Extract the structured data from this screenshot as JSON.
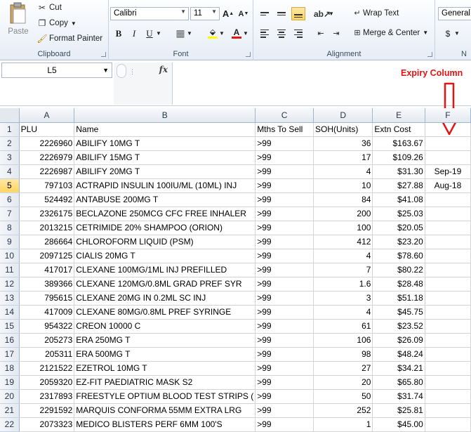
{
  "ribbon": {
    "clipboard": {
      "label": "Clipboard",
      "paste": "Paste",
      "cut": "Cut",
      "copy": "Copy",
      "format_painter": "Format Painter"
    },
    "font": {
      "label": "Font",
      "name": "Calibri",
      "size": "11",
      "bold": "B",
      "italic": "I",
      "underline": "U"
    },
    "alignment": {
      "label": "Alignment",
      "wrap_text": "Wrap Text",
      "merge_center": "Merge & Center"
    },
    "number": {
      "label": "N",
      "format": "General",
      "currency": "$"
    }
  },
  "formula_bar": {
    "name_box": "L5",
    "fx": "fx",
    "formula": ""
  },
  "annotation": {
    "text": "Expiry Column",
    "color": "#e31414"
  },
  "colors": {
    "accent": "#ffd35e",
    "header_bg": "#e4e9f0"
  },
  "sheet": {
    "columns": [
      "A",
      "B",
      "C",
      "D",
      "E",
      "F"
    ],
    "selected_row": 5,
    "rows": [
      {
        "n": "1",
        "a": "PLU",
        "b": "Name",
        "c": "Mths To Sell",
        "d": "SOH(Units)",
        "e": "Extn Cost",
        "f": ""
      },
      {
        "n": "2",
        "a": "2226960",
        "b": "ABILIFY 10MG T",
        "c": ">99",
        "d": "36",
        "e": "$163.67",
        "f": ""
      },
      {
        "n": "3",
        "a": "2226979",
        "b": "ABILIFY 15MG T",
        "c": ">99",
        "d": "17",
        "e": "$109.26",
        "f": ""
      },
      {
        "n": "4",
        "a": "2226987",
        "b": "ABILIFY 20MG T",
        "c": ">99",
        "d": "4",
        "e": "$31.30",
        "f": "Sep-19"
      },
      {
        "n": "5",
        "a": "797103",
        "b": "ACTRAPID INSULIN 100IU/ML (10ML) INJ",
        "c": ">99",
        "d": "10",
        "e": "$27.88",
        "f": "Aug-18"
      },
      {
        "n": "6",
        "a": "524492",
        "b": "ANTABUSE 200MG T",
        "c": ">99",
        "d": "84",
        "e": "$41.08",
        "f": ""
      },
      {
        "n": "7",
        "a": "2326175",
        "b": "BECLAZONE 250MCG CFC FREE INHALER",
        "c": ">99",
        "d": "200",
        "e": "$25.03",
        "f": ""
      },
      {
        "n": "8",
        "a": "2013215",
        "b": "CETRIMIDE 20% SHAMPOO (ORION)",
        "c": ">99",
        "d": "100",
        "e": "$20.05",
        "f": ""
      },
      {
        "n": "9",
        "a": "286664",
        "b": "CHLOROFORM LIQUID (PSM)",
        "c": ">99",
        "d": "412",
        "e": "$23.20",
        "f": ""
      },
      {
        "n": "10",
        "a": "2097125",
        "b": "CIALIS 20MG T",
        "c": ">99",
        "d": "4",
        "e": "$78.60",
        "f": ""
      },
      {
        "n": "11",
        "a": "417017",
        "b": "CLEXANE 100MG/1ML INJ PREFILLED",
        "c": ">99",
        "d": "7",
        "e": "$80.22",
        "f": ""
      },
      {
        "n": "12",
        "a": "389366",
        "b": "CLEXANE 120MG/0.8ML GRAD PREF SYR",
        "c": ">99",
        "d": "1.6",
        "e": "$28.48",
        "f": ""
      },
      {
        "n": "13",
        "a": "795615",
        "b": "CLEXANE 20MG IN 0.2ML SC INJ",
        "c": ">99",
        "d": "3",
        "e": "$51.18",
        "f": ""
      },
      {
        "n": "14",
        "a": "417009",
        "b": "CLEXANE 80MG/0.8ML PREF SYRINGE",
        "c": ">99",
        "d": "4",
        "e": "$45.75",
        "f": ""
      },
      {
        "n": "15",
        "a": "954322",
        "b": "CREON 10000 C",
        "c": ">99",
        "d": "61",
        "e": "$23.52",
        "f": ""
      },
      {
        "n": "16",
        "a": "205273",
        "b": "ERA 250MG T",
        "c": ">99",
        "d": "106",
        "e": "$26.09",
        "f": ""
      },
      {
        "n": "17",
        "a": "205311",
        "b": "ERA 500MG T",
        "c": ">99",
        "d": "98",
        "e": "$48.24",
        "f": ""
      },
      {
        "n": "18",
        "a": "2121522",
        "b": "EZETROL 10MG T",
        "c": ">99",
        "d": "27",
        "e": "$34.21",
        "f": ""
      },
      {
        "n": "19",
        "a": "2059320",
        "b": "EZ-FIT PAEDIATRIC MASK S2",
        "c": ">99",
        "d": "20",
        "e": "$65.80",
        "f": ""
      },
      {
        "n": "20",
        "a": "2317893",
        "b": "FREESTYLE OPTIUM BLOOD TEST STRIPS (",
        "c": ">99",
        "d": "50",
        "e": "$31.74",
        "f": ""
      },
      {
        "n": "21",
        "a": "2291592",
        "b": "MARQUIS CONFORMA 55MM EXTRA LRG",
        "c": ">99",
        "d": "252",
        "e": "$25.81",
        "f": ""
      },
      {
        "n": "22",
        "a": "2073323",
        "b": "MEDICO BLISTERS PERF 6MM 100'S",
        "c": ">99",
        "d": "1",
        "e": "$45.00",
        "f": ""
      }
    ]
  }
}
